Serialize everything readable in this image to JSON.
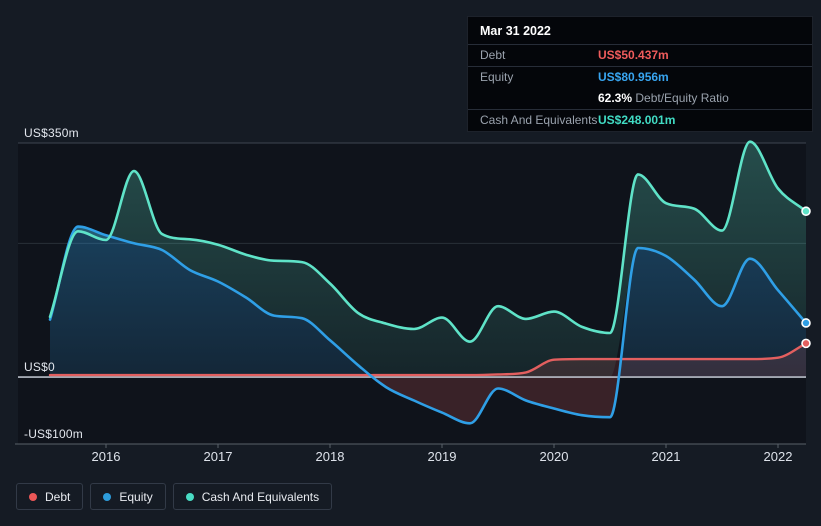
{
  "tooltip": {
    "date": "Mar 31 2022",
    "debt_label": "Debt",
    "debt_value": "US$50.437m",
    "equity_label": "Equity",
    "equity_value": "US$80.956m",
    "ratio_value": "62.3%",
    "ratio_label": "Debt/Equity Ratio",
    "cash_label": "Cash And Equivalents",
    "cash_value": "US$248.001m"
  },
  "colors": {
    "debt_line": "#e35f5f",
    "equity_line": "#2f9fe6",
    "cash_line": "#5fe3c8",
    "debt_text": "#f05c5c",
    "equity_text": "#38a5f0",
    "cash_text": "#41dcc4",
    "debt_dot": "#eb5757",
    "equity_dot": "#2d9cdb",
    "cash_dot": "#49dcc4",
    "zero_line": "#b8bec8",
    "grid_strong": "#3e4450",
    "grid_faint": "#293039",
    "axis_line": "#596069"
  },
  "legend": {
    "items": [
      {
        "label": "Debt",
        "color": "#eb5757"
      },
      {
        "label": "Equity",
        "color": "#2d9cdb"
      },
      {
        "label": "Cash And Equivalents",
        "color": "#49dcc4"
      }
    ]
  },
  "chart_data": {
    "type": "area",
    "title": "",
    "xlabel": "",
    "ylabel": "",
    "ylim": [
      -100,
      350
    ],
    "x_ticks": [
      "2016",
      "2017",
      "2018",
      "2019",
      "2020",
      "2021",
      "2022"
    ],
    "x_tick_years": [
      2016,
      2017,
      2018,
      2019,
      2020,
      2021,
      2022
    ],
    "y_ticks": [
      {
        "value": 350,
        "label": "US$350m"
      },
      {
        "value": 0,
        "label": "US$0"
      },
      {
        "value": -100,
        "label": "-US$100m"
      }
    ],
    "grid_values": [
      350,
      200
    ],
    "legend_position": "bottom",
    "x": [
      2015.5,
      2015.75,
      2016.0,
      2016.25,
      2016.5,
      2016.75,
      2017.0,
      2017.25,
      2017.5,
      2017.75,
      2018.0,
      2018.25,
      2018.5,
      2018.75,
      2019.0,
      2019.25,
      2019.5,
      2019.75,
      2020.0,
      2020.25,
      2020.5,
      2020.75,
      2021.0,
      2021.25,
      2021.5,
      2021.75,
      2022.0,
      2022.25
    ],
    "series": [
      {
        "name": "Debt",
        "unit": "US$m",
        "values": [
          3,
          3,
          3,
          3,
          3,
          3,
          3,
          3,
          3,
          3,
          3,
          3,
          3,
          3,
          3,
          3,
          4,
          7,
          26,
          27,
          27,
          27,
          27,
          27,
          27,
          27,
          29,
          50.437
        ]
      },
      {
        "name": "Equity",
        "unit": "US$m",
        "values": [
          86,
          225,
          212,
          200,
          190,
          160,
          143,
          119,
          92,
          88,
          55,
          18,
          -15,
          -35,
          -53,
          -69,
          -17,
          -35,
          -47,
          -57,
          -60,
          193,
          181,
          146,
          106,
          177,
          130,
          80.956
        ]
      },
      {
        "name": "Cash And Equivalents",
        "unit": "US$m",
        "values": [
          90,
          218,
          205,
          308,
          214,
          206,
          198,
          183,
          174,
          172,
          140,
          96,
          80,
          72,
          89,
          53,
          106,
          87,
          98,
          75,
          66,
          303,
          260,
          252,
          219,
          352,
          282,
          248.001
        ]
      }
    ]
  }
}
